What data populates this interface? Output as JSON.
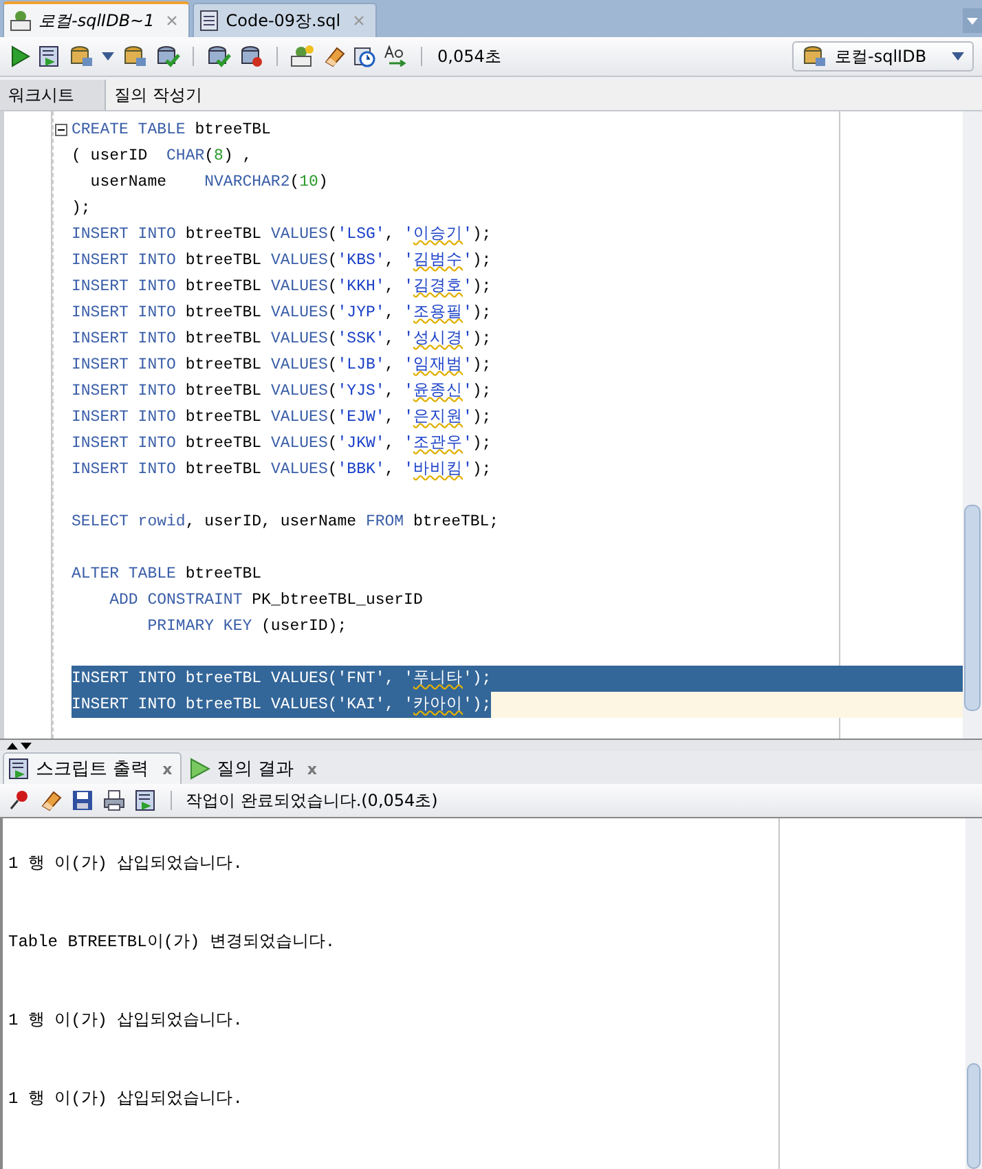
{
  "doc_tabs": [
    {
      "label": "로컬-sqlIDB~1",
      "selected": true,
      "italic": true
    },
    {
      "label": "Code-09장.sql",
      "selected": false,
      "italic": false
    }
  ],
  "toolbar": {
    "elapsed": "0,054초",
    "connection": "로컬-sqlIDB"
  },
  "sub_tabs": [
    {
      "label": "워크시트",
      "selected": true
    },
    {
      "label": "질의 작성기",
      "selected": false
    }
  ],
  "editor": {
    "lines": [
      {
        "kind": "fold",
        "selected": false,
        "current": false,
        "segments": [
          {
            "kind": "kw",
            "text": "CREATE TABLE"
          },
          {
            "kind": "plain",
            "text": " btreeTBL"
          }
        ]
      },
      {
        "kind": "code",
        "selected": false,
        "current": false,
        "segments": [
          {
            "kind": "plain",
            "text": "( userID  "
          },
          {
            "kind": "kw",
            "text": "CHAR"
          },
          {
            "kind": "plain",
            "text": "("
          },
          {
            "kind": "num",
            "text": "8"
          },
          {
            "kind": "plain",
            "text": ") ,"
          }
        ]
      },
      {
        "kind": "code",
        "selected": false,
        "current": false,
        "segments": [
          {
            "kind": "plain",
            "text": "  userName    "
          },
          {
            "kind": "kw",
            "text": "NVARCHAR2"
          },
          {
            "kind": "plain",
            "text": "("
          },
          {
            "kind": "num",
            "text": "10"
          },
          {
            "kind": "plain",
            "text": ")"
          }
        ]
      },
      {
        "kind": "code",
        "selected": false,
        "current": false,
        "segments": [
          {
            "kind": "plain",
            "text": ");"
          }
        ]
      },
      {
        "kind": "code",
        "selected": false,
        "current": false,
        "segments": [
          {
            "kind": "kw",
            "text": "INSERT INTO"
          },
          {
            "kind": "plain",
            "text": " btreeTBL "
          },
          {
            "kind": "kw",
            "text": "VALUES"
          },
          {
            "kind": "plain",
            "text": "("
          },
          {
            "kind": "str",
            "text": "'LSG'"
          },
          {
            "kind": "plain",
            "text": ", "
          },
          {
            "kind": "str",
            "text": "'"
          },
          {
            "kind": "flagged",
            "text": "이승기"
          },
          {
            "kind": "str",
            "text": "'"
          },
          {
            "kind": "plain",
            "text": ");"
          }
        ]
      },
      {
        "kind": "code",
        "selected": false,
        "current": false,
        "segments": [
          {
            "kind": "kw",
            "text": "INSERT INTO"
          },
          {
            "kind": "plain",
            "text": " btreeTBL "
          },
          {
            "kind": "kw",
            "text": "VALUES"
          },
          {
            "kind": "plain",
            "text": "("
          },
          {
            "kind": "str",
            "text": "'KBS'"
          },
          {
            "kind": "plain",
            "text": ", "
          },
          {
            "kind": "str",
            "text": "'"
          },
          {
            "kind": "flagged",
            "text": "김범수"
          },
          {
            "kind": "str",
            "text": "'"
          },
          {
            "kind": "plain",
            "text": ");"
          }
        ]
      },
      {
        "kind": "code",
        "selected": false,
        "current": false,
        "segments": [
          {
            "kind": "kw",
            "text": "INSERT INTO"
          },
          {
            "kind": "plain",
            "text": " btreeTBL "
          },
          {
            "kind": "kw",
            "text": "VALUES"
          },
          {
            "kind": "plain",
            "text": "("
          },
          {
            "kind": "str",
            "text": "'KKH'"
          },
          {
            "kind": "plain",
            "text": ", "
          },
          {
            "kind": "str",
            "text": "'"
          },
          {
            "kind": "flagged",
            "text": "김경호"
          },
          {
            "kind": "str",
            "text": "'"
          },
          {
            "kind": "plain",
            "text": ");"
          }
        ]
      },
      {
        "kind": "code",
        "selected": false,
        "current": false,
        "segments": [
          {
            "kind": "kw",
            "text": "INSERT INTO"
          },
          {
            "kind": "plain",
            "text": " btreeTBL "
          },
          {
            "kind": "kw",
            "text": "VALUES"
          },
          {
            "kind": "plain",
            "text": "("
          },
          {
            "kind": "str",
            "text": "'JYP'"
          },
          {
            "kind": "plain",
            "text": ", "
          },
          {
            "kind": "str",
            "text": "'"
          },
          {
            "kind": "flagged",
            "text": "조용필"
          },
          {
            "kind": "str",
            "text": "'"
          },
          {
            "kind": "plain",
            "text": ");"
          }
        ]
      },
      {
        "kind": "code",
        "selected": false,
        "current": false,
        "segments": [
          {
            "kind": "kw",
            "text": "INSERT INTO"
          },
          {
            "kind": "plain",
            "text": " btreeTBL "
          },
          {
            "kind": "kw",
            "text": "VALUES"
          },
          {
            "kind": "plain",
            "text": "("
          },
          {
            "kind": "str",
            "text": "'SSK'"
          },
          {
            "kind": "plain",
            "text": ", "
          },
          {
            "kind": "str",
            "text": "'"
          },
          {
            "kind": "flagged",
            "text": "성시경"
          },
          {
            "kind": "str",
            "text": "'"
          },
          {
            "kind": "plain",
            "text": ");"
          }
        ]
      },
      {
        "kind": "code",
        "selected": false,
        "current": false,
        "segments": [
          {
            "kind": "kw",
            "text": "INSERT INTO"
          },
          {
            "kind": "plain",
            "text": " btreeTBL "
          },
          {
            "kind": "kw",
            "text": "VALUES"
          },
          {
            "kind": "plain",
            "text": "("
          },
          {
            "kind": "str",
            "text": "'LJB'"
          },
          {
            "kind": "plain",
            "text": ", "
          },
          {
            "kind": "str",
            "text": "'"
          },
          {
            "kind": "flagged",
            "text": "임재범"
          },
          {
            "kind": "str",
            "text": "'"
          },
          {
            "kind": "plain",
            "text": ");"
          }
        ]
      },
      {
        "kind": "code",
        "selected": false,
        "current": false,
        "segments": [
          {
            "kind": "kw",
            "text": "INSERT INTO"
          },
          {
            "kind": "plain",
            "text": " btreeTBL "
          },
          {
            "kind": "kw",
            "text": "VALUES"
          },
          {
            "kind": "plain",
            "text": "("
          },
          {
            "kind": "str",
            "text": "'YJS'"
          },
          {
            "kind": "plain",
            "text": ", "
          },
          {
            "kind": "str",
            "text": "'"
          },
          {
            "kind": "flagged",
            "text": "윤종신"
          },
          {
            "kind": "str",
            "text": "'"
          },
          {
            "kind": "plain",
            "text": ");"
          }
        ]
      },
      {
        "kind": "code",
        "selected": false,
        "current": false,
        "segments": [
          {
            "kind": "kw",
            "text": "INSERT INTO"
          },
          {
            "kind": "plain",
            "text": " btreeTBL "
          },
          {
            "kind": "kw",
            "text": "VALUES"
          },
          {
            "kind": "plain",
            "text": "("
          },
          {
            "kind": "str",
            "text": "'EJW'"
          },
          {
            "kind": "plain",
            "text": ", "
          },
          {
            "kind": "str",
            "text": "'"
          },
          {
            "kind": "flagged",
            "text": "은지원"
          },
          {
            "kind": "str",
            "text": "'"
          },
          {
            "kind": "plain",
            "text": ");"
          }
        ]
      },
      {
        "kind": "code",
        "selected": false,
        "current": false,
        "segments": [
          {
            "kind": "kw",
            "text": "INSERT INTO"
          },
          {
            "kind": "plain",
            "text": " btreeTBL "
          },
          {
            "kind": "kw",
            "text": "VALUES"
          },
          {
            "kind": "plain",
            "text": "("
          },
          {
            "kind": "str",
            "text": "'JKW'"
          },
          {
            "kind": "plain",
            "text": ", "
          },
          {
            "kind": "str",
            "text": "'"
          },
          {
            "kind": "flagged",
            "text": "조관우"
          },
          {
            "kind": "str",
            "text": "'"
          },
          {
            "kind": "plain",
            "text": ");"
          }
        ]
      },
      {
        "kind": "code",
        "selected": false,
        "current": false,
        "segments": [
          {
            "kind": "kw",
            "text": "INSERT INTO"
          },
          {
            "kind": "plain",
            "text": " btreeTBL "
          },
          {
            "kind": "kw",
            "text": "VALUES"
          },
          {
            "kind": "plain",
            "text": "("
          },
          {
            "kind": "str",
            "text": "'BBK'"
          },
          {
            "kind": "plain",
            "text": ", "
          },
          {
            "kind": "str",
            "text": "'"
          },
          {
            "kind": "flagged",
            "text": "바비킴"
          },
          {
            "kind": "str",
            "text": "'"
          },
          {
            "kind": "plain",
            "text": ");"
          }
        ]
      },
      {
        "kind": "blank"
      },
      {
        "kind": "code",
        "selected": false,
        "current": false,
        "segments": [
          {
            "kind": "kw",
            "text": "SELECT rowid"
          },
          {
            "kind": "plain",
            "text": ", userID, userName "
          },
          {
            "kind": "kw",
            "text": "FROM"
          },
          {
            "kind": "plain",
            "text": " btreeTBL;"
          }
        ]
      },
      {
        "kind": "blank"
      },
      {
        "kind": "code",
        "selected": false,
        "current": false,
        "segments": [
          {
            "kind": "kw",
            "text": "ALTER TABLE"
          },
          {
            "kind": "plain",
            "text": " btreeTBL"
          }
        ]
      },
      {
        "kind": "code",
        "selected": false,
        "current": false,
        "segments": [
          {
            "kind": "kw",
            "text": "    ADD CONSTRAINT"
          },
          {
            "kind": "plain",
            "text": " PK_btreeTBL_userID"
          }
        ]
      },
      {
        "kind": "code",
        "selected": false,
        "current": false,
        "segments": [
          {
            "kind": "kw",
            "text": "        PRIMARY KEY"
          },
          {
            "kind": "plain",
            "text": " (userID);"
          }
        ]
      },
      {
        "kind": "blank"
      },
      {
        "kind": "code",
        "selected": true,
        "current": false,
        "segments": [
          {
            "kind": "kw",
            "text": "INSERT INTO"
          },
          {
            "kind": "plain",
            "text": " btreeTBL "
          },
          {
            "kind": "kw",
            "text": "VALUES"
          },
          {
            "kind": "plain",
            "text": "("
          },
          {
            "kind": "str",
            "text": "'FNT'"
          },
          {
            "kind": "plain",
            "text": ", "
          },
          {
            "kind": "str",
            "text": "'"
          },
          {
            "kind": "flagged",
            "text": "푸니타"
          },
          {
            "kind": "str",
            "text": "'"
          },
          {
            "kind": "plain",
            "text": ");"
          }
        ]
      },
      {
        "kind": "code",
        "selected": true,
        "current": true,
        "segments": [
          {
            "kind": "kw",
            "text": "INSERT INTO"
          },
          {
            "kind": "plain",
            "text": " btreeTBL "
          },
          {
            "kind": "kw",
            "text": "VALUES"
          },
          {
            "kind": "plain",
            "text": "("
          },
          {
            "kind": "str",
            "text": "'KAI'"
          },
          {
            "kind": "plain",
            "text": ", "
          },
          {
            "kind": "str",
            "text": "'"
          },
          {
            "kind": "flagged",
            "text": "카아이"
          },
          {
            "kind": "str",
            "text": "'"
          },
          {
            "kind": "plain",
            "text": ");"
          }
        ]
      }
    ]
  },
  "output_tabs": [
    {
      "label": "스크립트 출력",
      "selected": true,
      "close": "x"
    },
    {
      "label": "질의 결과",
      "selected": false,
      "close": "x"
    }
  ],
  "output_status": "작업이 완료되었습니다.(0,054초)",
  "output_lines": [
    "1 행 이(가) 삽입되었습니다.",
    "Table BTREETBL이(가) 변경되었습니다.",
    "1 행 이(가) 삽입되었습니다.",
    "1 행 이(가) 삽입되었습니다."
  ]
}
